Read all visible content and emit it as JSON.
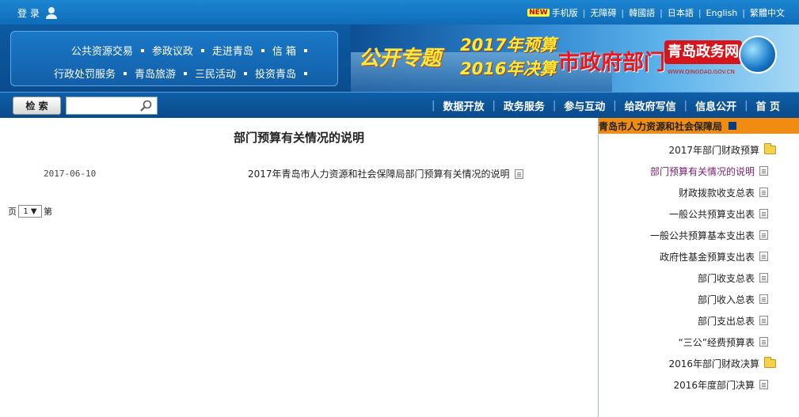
{
  "topbar": {
    "login": "登 录",
    "links": [
      "手机版",
      "无障碍",
      "韓國語",
      "日本語",
      "English",
      "繁體中文"
    ],
    "new_badge": "NEW"
  },
  "nav": {
    "row1": [
      "公共资源交易",
      "参政议政",
      "走进青岛",
      "信 箱"
    ],
    "row2": [
      "行政处罚服务",
      "青岛旅游",
      "三民活动",
      "投资青岛"
    ]
  },
  "banner": {
    "zhuanti": "公开专题",
    "year1": "2017年预算",
    "year2": "2016年决算",
    "gov": "市政府部门",
    "site_name": "青岛政务网",
    "site_url": "WWW.QINGDAO.GOV.CN"
  },
  "search": {
    "button": "检 索",
    "placeholder": ""
  },
  "menu": [
    "数据开放",
    "政务服务",
    "参与互动",
    "给政府写信",
    "信息公开",
    "首 页"
  ],
  "content": {
    "page_title": "部门预算有关情况的说明",
    "article_title": "2017年青岛市人力资源和社会保障局部门预算有关情况的说明",
    "article_date": "2017-06-10",
    "pager_prefix": "第",
    "pager_value": "1",
    "pager_suffix": "页"
  },
  "sidebar": {
    "header": "青岛市人力资源和社会保障局",
    "items": [
      {
        "label": "2017年部门财政预算",
        "type": "folder"
      },
      {
        "label": "部门预算有关情况的说明",
        "type": "doc",
        "active": true
      },
      {
        "label": "财政拨款收支总表",
        "type": "doc"
      },
      {
        "label": "一般公共预算支出表",
        "type": "doc"
      },
      {
        "label": "一般公共预算基本支出表",
        "type": "doc"
      },
      {
        "label": "政府性基金预算支出表",
        "type": "doc"
      },
      {
        "label": "部门收支总表",
        "type": "doc"
      },
      {
        "label": "部门收入总表",
        "type": "doc"
      },
      {
        "label": "部门支出总表",
        "type": "doc"
      },
      {
        "label": "“三公”经费预算表",
        "type": "doc"
      },
      {
        "label": "2016年部门财政决算",
        "type": "folder"
      },
      {
        "label": "2016年度部门决算",
        "type": "doc"
      }
    ]
  }
}
